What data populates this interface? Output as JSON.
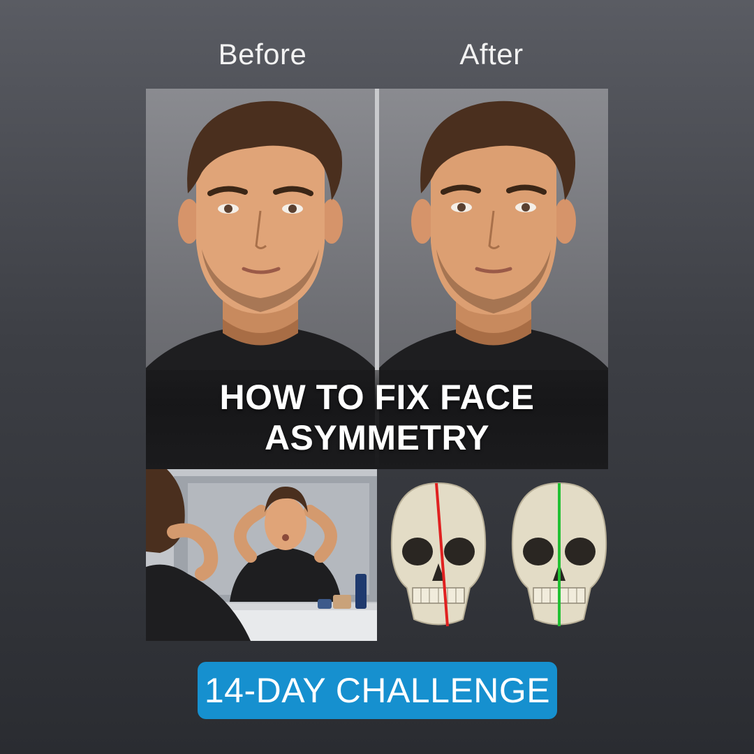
{
  "labels": {
    "before": "Before",
    "after": "After"
  },
  "title": {
    "line1": "HOW TO FIX FACE",
    "line2": "ASYMMETRY"
  },
  "cta": {
    "label": "14-DAY CHALLENGE"
  },
  "colors": {
    "cta_background": "#1690cf",
    "asymmetric_line": "#e02020",
    "symmetric_line": "#22c032",
    "background_top": "#5a5c63",
    "background_bottom": "#2a2c31"
  },
  "icons": [
    "face-before-illustration",
    "face-after-illustration",
    "mirror-exercise-illustration",
    "skull-asymmetric-icon",
    "skull-symmetric-icon"
  ]
}
